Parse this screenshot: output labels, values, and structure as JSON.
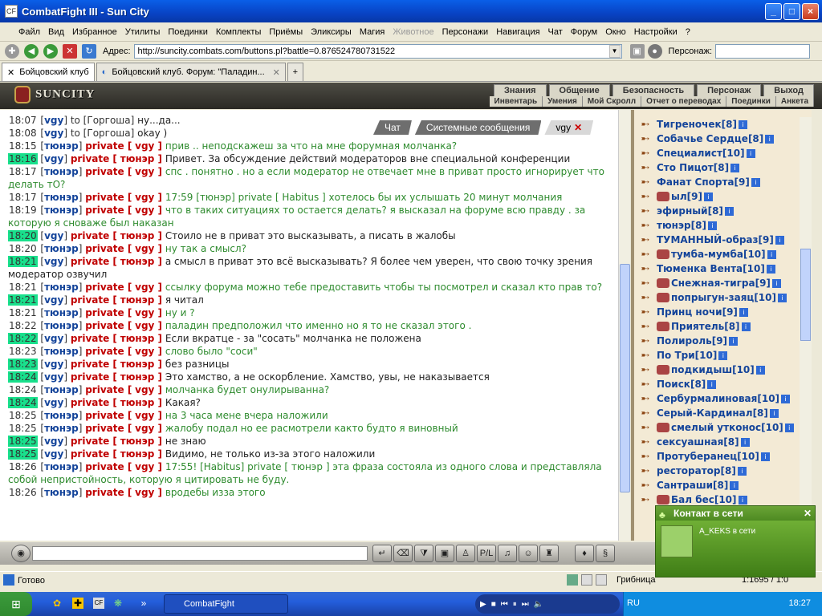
{
  "window": {
    "title": "CombatFight III - Sun City"
  },
  "menu": [
    "Файл",
    "Вид",
    "Избранное",
    "Утилиты",
    "Поединки",
    "Комплекты",
    "Приёмы",
    "Эликсиры",
    "Магия",
    "Животное",
    "Персонажи",
    "Навигация",
    "Чат",
    "Форум",
    "Окно",
    "Настройки",
    "?"
  ],
  "address": {
    "label": "Адрес:",
    "url": "http://suncity.combats.com/buttons.pl?battle=0.876524780731522",
    "person_label": "Персонаж:"
  },
  "tabs": [
    "Бойцовский клуб",
    "Бойцовский клуб. Форум: \"Паладин..."
  ],
  "game": {
    "logo": "SUNCITY",
    "top_links": [
      "Знания",
      "Общение",
      "Безопасность",
      "Персонаж",
      "Выход"
    ],
    "sub_links": [
      "Инвентарь",
      "Умения",
      "Мой Скролл",
      "Отчет о переводах",
      "Поединки",
      "Анкета"
    ]
  },
  "chat_tabs": [
    "Чат",
    "Системные сообщения",
    "vgy"
  ],
  "chat_lines": [
    {
      "time": "18:07",
      "hl": false,
      "from": "vgy",
      "priv": false,
      "to": "Горгоша",
      "msg": "ну...да...",
      "color": "dark"
    },
    {
      "time": "18:08",
      "hl": false,
      "from": "vgy",
      "priv": false,
      "to": "Горгоша",
      "msg": "okay )",
      "color": "dark"
    },
    {
      "time": "18:15",
      "hl": false,
      "from": "тюнэр",
      "priv": true,
      "to": "vgy",
      "msg": "прив .. неподскажеш за что на мне форумная молчанка?",
      "color": "green"
    },
    {
      "time": "18:16",
      "hl": true,
      "from": "vgy",
      "priv": true,
      "to": "тюнэр",
      "msg": "Привет. За обсуждение действий модераторов вне специальной конференции",
      "color": "dark"
    },
    {
      "time": "18:17",
      "hl": false,
      "from": "тюнэр",
      "priv": true,
      "to": "vgy",
      "msg": "спс . понятно . но а если модератор не отвечает мне в приват просто игнорирует что делать тО?",
      "color": "green"
    },
    {
      "time": "18:17",
      "hl": false,
      "from": "тюнэр",
      "priv": true,
      "to": "vgy",
      "msg": "17:59 [тюнэр] private [ Habitus ] хотелось бы их услышать 20 минут молчания",
      "color": "green"
    },
    {
      "time": "18:19",
      "hl": false,
      "from": "тюнэр",
      "priv": true,
      "to": "vgy",
      "msg": "что в таких ситуациях то остается делать? я высказал на форуме всю правду . за которую я сноваже был наказан",
      "color": "green"
    },
    {
      "time": "18:20",
      "hl": true,
      "from": "vgy",
      "priv": true,
      "to": "тюнэр",
      "msg": "Стоило не в приват это высказывать, а писать в жалобы",
      "color": "dark"
    },
    {
      "time": "18:20",
      "hl": false,
      "from": "тюнэр",
      "priv": true,
      "to": "vgy",
      "msg": "ну так а смысл?",
      "color": "green"
    },
    {
      "time": "18:21",
      "hl": true,
      "from": "vgy",
      "priv": true,
      "to": "тюнэр",
      "msg": "а смысл в приват это всё высказывать? Я более чем уверен, что свою точку зрения модератор озвучил",
      "color": "dark"
    },
    {
      "time": "18:21",
      "hl": false,
      "from": "тюнэр",
      "priv": true,
      "to": "vgy",
      "msg": "ссылку форума можно тебе предоставить чтобы ты посмотрел и сказал кто прав то?",
      "color": "green"
    },
    {
      "time": "18:21",
      "hl": true,
      "from": "vgy",
      "priv": true,
      "to": "тюнэр",
      "msg": "я читал",
      "color": "dark"
    },
    {
      "time": "18:21",
      "hl": false,
      "from": "тюнэр",
      "priv": true,
      "to": "vgy",
      "msg": "ну и ?",
      "color": "green"
    },
    {
      "time": "18:22",
      "hl": false,
      "from": "тюнэр",
      "priv": true,
      "to": "vgy",
      "msg": "паладин предположил что именно но я то не сказал этого .",
      "color": "green"
    },
    {
      "time": "18:22",
      "hl": true,
      "from": "vgy",
      "priv": true,
      "to": "тюнэр",
      "msg": "Если вкратце - за \"сосать\" молчанка не положена",
      "color": "dark"
    },
    {
      "time": "18:23",
      "hl": false,
      "from": "тюнэр",
      "priv": true,
      "to": "vgy",
      "msg": "слово было \"соси\"",
      "color": "green"
    },
    {
      "time": "18:23",
      "hl": true,
      "from": "vgy",
      "priv": true,
      "to": "тюнэр",
      "msg": "без разницы",
      "color": "dark"
    },
    {
      "time": "18:24",
      "hl": true,
      "from": "vgy",
      "priv": true,
      "to": "тюнэр",
      "msg": "Это хамство, а не оскорбление. Хамство, увы, не наказывается",
      "color": "dark"
    },
    {
      "time": "18:24",
      "hl": false,
      "from": "тюнэр",
      "priv": true,
      "to": "vgy",
      "msg": "молчанка будет онулирыванна?",
      "color": "green"
    },
    {
      "time": "18:24",
      "hl": true,
      "from": "vgy",
      "priv": true,
      "to": "тюнэр",
      "msg": "Какая?",
      "color": "dark"
    },
    {
      "time": "18:25",
      "hl": false,
      "from": "тюнэр",
      "priv": true,
      "to": "vgy",
      "msg": "на 3 часа мене вчера наложили",
      "color": "green"
    },
    {
      "time": "18:25",
      "hl": false,
      "from": "тюнэр",
      "priv": true,
      "to": "vgy",
      "msg": "жалобу подал но ее расмотрели както будто я виновный",
      "color": "green"
    },
    {
      "time": "18:25",
      "hl": true,
      "from": "vgy",
      "priv": true,
      "to": "тюнэр",
      "msg": "не знаю",
      "color": "dark"
    },
    {
      "time": "18:25",
      "hl": true,
      "from": "vgy",
      "priv": true,
      "to": "тюнэр",
      "msg": "Видимо, не только из-за этого наложили",
      "color": "dark"
    },
    {
      "time": "18:26",
      "hl": false,
      "from": "тюнэр",
      "priv": true,
      "to": "vgy",
      "msg": "17:55! [Habitus] private [ тюнэр ] эта фраза состояла из одного слова и представляла собой непристойность, которую я цитировать не буду.",
      "color": "green"
    },
    {
      "time": "18:26",
      "hl": false,
      "from": "тюнэр",
      "priv": true,
      "to": "vgy",
      "msg": "вродебы изза этого",
      "color": "green"
    }
  ],
  "users": [
    {
      "name": "Тигреночек",
      "lvl": "[8]",
      "avatar": false
    },
    {
      "name": "Собачье Сердце",
      "lvl": "[8]",
      "avatar": false
    },
    {
      "name": "Специалист",
      "lvl": "[10]",
      "avatar": false
    },
    {
      "name": "Сто Пицот",
      "lvl": "[8]",
      "avatar": false
    },
    {
      "name": "Фанат Спорта",
      "lvl": "[9]",
      "avatar": false
    },
    {
      "name": "ыл",
      "lvl": "[9]",
      "avatar": true
    },
    {
      "name": "эфирный",
      "lvl": "[8]",
      "avatar": false
    },
    {
      "name": "тюнэр",
      "lvl": "[8]",
      "avatar": false
    },
    {
      "name": "ТУМАННЫЙ-образ",
      "lvl": "[9]",
      "avatar": false
    },
    {
      "name": "тумба-мумба",
      "lvl": "[10]",
      "avatar": true
    },
    {
      "name": "Тюменка Вента",
      "lvl": "[10]",
      "avatar": false
    },
    {
      "name": "Снежная-тигра",
      "lvl": "[9]",
      "avatar": true
    },
    {
      "name": "попрыгун-заяц",
      "lvl": "[10]",
      "avatar": true
    },
    {
      "name": "Принц ночи",
      "lvl": "[9]",
      "avatar": false
    },
    {
      "name": "Приятель",
      "lvl": "[8]",
      "avatar": true
    },
    {
      "name": "Полироль",
      "lvl": "[9]",
      "avatar": false
    },
    {
      "name": "По Три",
      "lvl": "[10]",
      "avatar": false
    },
    {
      "name": "подкидыш",
      "lvl": "[10]",
      "avatar": true
    },
    {
      "name": "Поиск",
      "lvl": "[8]",
      "avatar": false
    },
    {
      "name": "Сербурмалиновая",
      "lvl": "[10]",
      "avatar": false
    },
    {
      "name": "Серый-Кардинал",
      "lvl": "[8]",
      "avatar": false
    },
    {
      "name": "смелый утконос",
      "lvl": "[10]",
      "avatar": true
    },
    {
      "name": "сексуашная",
      "lvl": "[8]",
      "avatar": false
    },
    {
      "name": "Протуберанец",
      "lvl": "[10]",
      "avatar": false
    },
    {
      "name": "ресторатор",
      "lvl": "[8]",
      "avatar": false
    },
    {
      "name": "Сантраши",
      "lvl": "[8]",
      "avatar": false
    },
    {
      "name": "Бал бес",
      "lvl": "[10]",
      "avatar": true
    }
  ],
  "toast": {
    "title": "Контакт в сети",
    "msg": "A_KEKS в сети"
  },
  "status": {
    "text": "Готово",
    "zone": "Грибница",
    "coords": "1:1695 / 1:0"
  },
  "taskbar": {
    "item": "CombatFight",
    "lang": "RU",
    "clock": "18:27"
  },
  "colors": {
    "highlight": "#19E08C",
    "private": "#C00000",
    "nick": "#14449A",
    "green_msg": "#2E8B2E"
  }
}
